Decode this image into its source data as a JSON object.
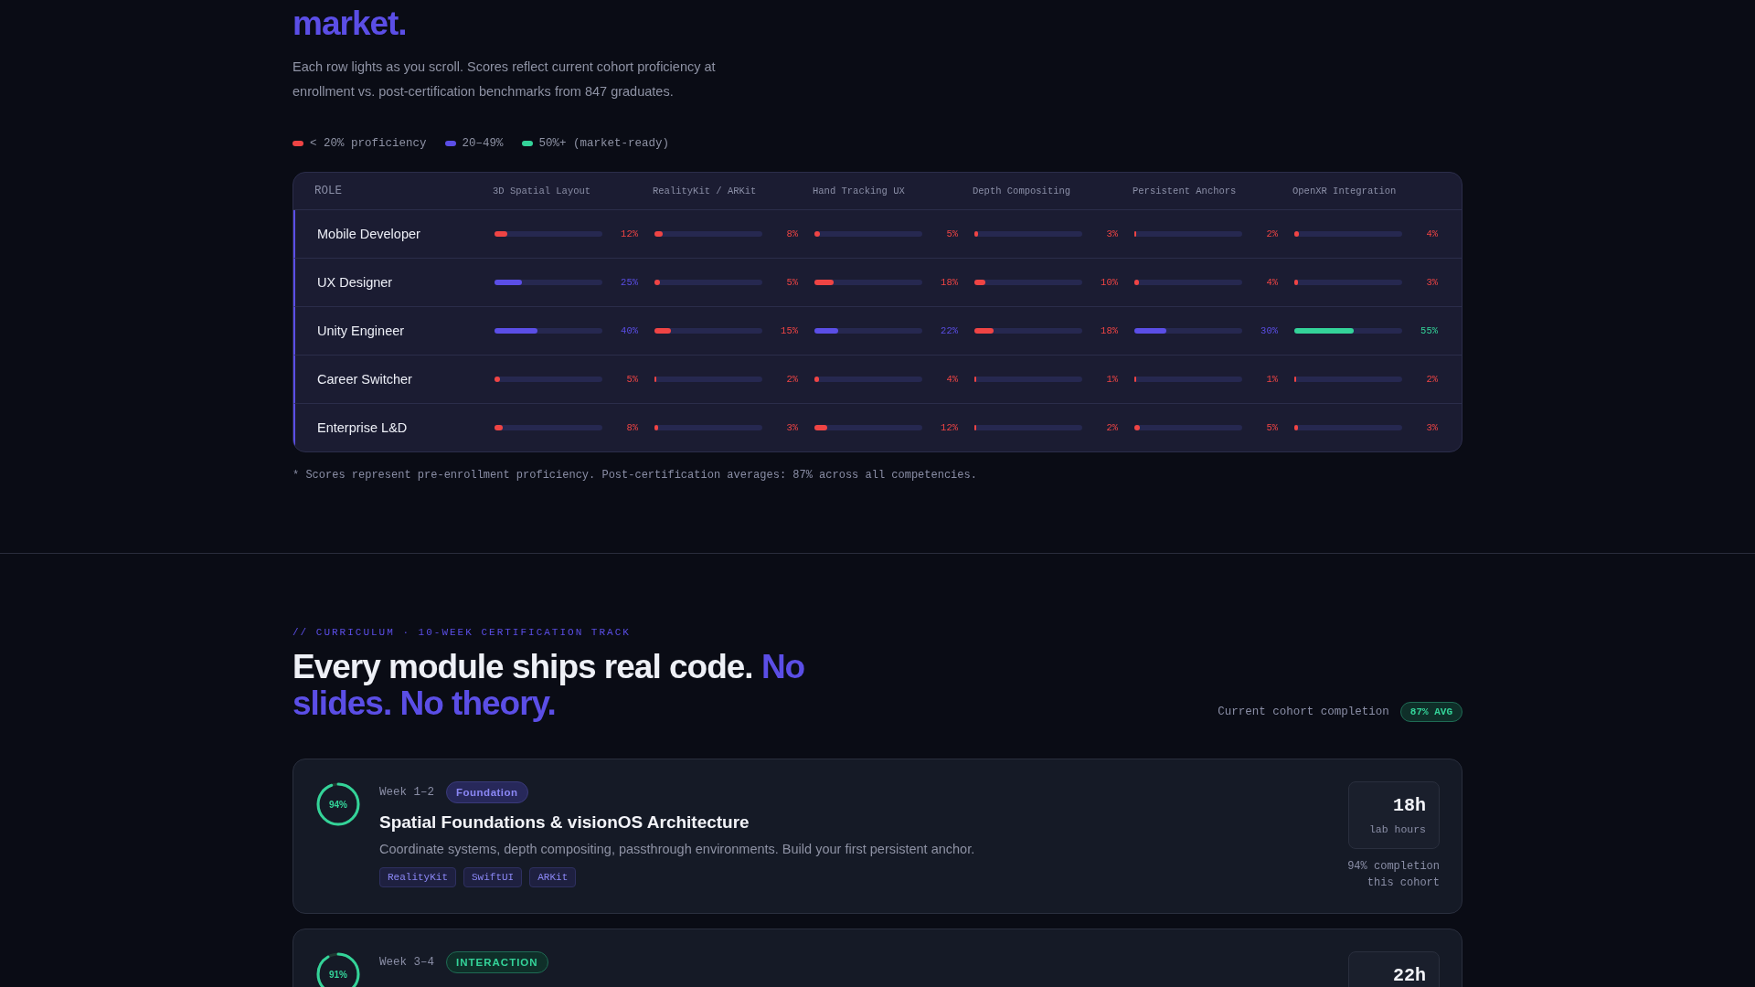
{
  "skills_section": {
    "heading": "market.",
    "intro": "Each row lights as you scroll. Scores reflect current cohort proficiency at enrollment vs. post-certification benchmarks from 847 graduates.",
    "legend": [
      {
        "label": "< 20% proficiency",
        "color": "#ef4444"
      },
      {
        "label": "20–49%",
        "color": "#5b4ee6"
      },
      {
        "label": "50%+ (market-ready)",
        "color": "#34d399"
      }
    ],
    "table": {
      "columns": [
        "ROLE",
        "3D Spatial Layout",
        "RealityKit / ARKit",
        "Hand Tracking UX",
        "Depth Compositing",
        "Persistent Anchors",
        "OpenXR Integration"
      ],
      "rows": [
        {
          "role": "Mobile Developer",
          "scores": [
            {
              "level": 0.12,
              "reading": "12%",
              "color": "#ef4444"
            },
            {
              "level": 0.08,
              "reading": "8%",
              "color": "#ef4444"
            },
            {
              "level": 0.05,
              "reading": "5%",
              "color": "#ef4444"
            },
            {
              "level": 0.03,
              "reading": "3%",
              "color": "#ef4444"
            },
            {
              "level": 0.02,
              "reading": "2%",
              "color": "#ef4444"
            },
            {
              "level": 0.04,
              "reading": "4%",
              "color": "#ef4444"
            }
          ]
        },
        {
          "role": "UX Designer",
          "scores": [
            {
              "level": 0.25,
              "reading": "25%",
              "color": "#5b4ee6"
            },
            {
              "level": 0.05,
              "reading": "5%",
              "color": "#ef4444"
            },
            {
              "level": 0.18,
              "reading": "18%",
              "color": "#ef4444"
            },
            {
              "level": 0.1,
              "reading": "10%",
              "color": "#ef4444"
            },
            {
              "level": 0.04,
              "reading": "4%",
              "color": "#ef4444"
            },
            {
              "level": 0.03,
              "reading": "3%",
              "color": "#ef4444"
            }
          ]
        },
        {
          "role": "Unity Engineer",
          "scores": [
            {
              "level": 0.4,
              "reading": "40%",
              "color": "#5b4ee6"
            },
            {
              "level": 0.15,
              "reading": "15%",
              "color": "#ef4444"
            },
            {
              "level": 0.22,
              "reading": "22%",
              "color": "#5b4ee6"
            },
            {
              "level": 0.18,
              "reading": "18%",
              "color": "#ef4444"
            },
            {
              "level": 0.3,
              "reading": "30%",
              "color": "#5b4ee6"
            },
            {
              "level": 0.55,
              "reading": "55%",
              "color": "#34d399"
            }
          ]
        },
        {
          "role": "Career Switcher",
          "scores": [
            {
              "level": 0.05,
              "reading": "5%",
              "color": "#ef4444"
            },
            {
              "level": 0.02,
              "reading": "2%",
              "color": "#ef4444"
            },
            {
              "level": 0.04,
              "reading": "4%",
              "color": "#ef4444"
            },
            {
              "level": 0.01,
              "reading": "1%",
              "color": "#ef4444"
            },
            {
              "level": 0.01,
              "reading": "1%",
              "color": "#ef4444"
            },
            {
              "level": 0.02,
              "reading": "2%",
              "color": "#ef4444"
            }
          ]
        },
        {
          "role": "Enterprise L&D",
          "scores": [
            {
              "level": 0.08,
              "reading": "8%",
              "color": "#ef4444"
            },
            {
              "level": 0.03,
              "reading": "3%",
              "color": "#ef4444"
            },
            {
              "level": 0.12,
              "reading": "12%",
              "color": "#ef4444"
            },
            {
              "level": 0.02,
              "reading": "2%",
              "color": "#ef4444"
            },
            {
              "level": 0.05,
              "reading": "5%",
              "color": "#ef4444"
            },
            {
              "level": 0.03,
              "reading": "3%",
              "color": "#ef4444"
            }
          ]
        }
      ]
    },
    "footnote": "* Scores represent pre-enrollment proficiency. Post-certification averages: 87% across all competencies."
  },
  "curriculum": {
    "eyebrow": "// CURRICULUM · 10-WEEK CERTIFICATION TRACK",
    "heading_plain": "Every module ships real code.",
    "heading_accent": "No slides. No theory.",
    "completion_label": "Current cohort completion",
    "completion_badge": "87% AVG",
    "modules": [
      {
        "ring_label": "94%",
        "weeks": "Week 1–2",
        "tag": {
          "label": "Foundation",
          "kind": "foundation"
        },
        "title": "Spatial Foundations & visionOS Architecture",
        "description": "Coordinate systems, depth compositing, passthrough environments. Build your first persistent anchor.",
        "tools": [
          "RealityKit",
          "SwiftUI",
          "ARKit"
        ],
        "hours": "18h",
        "hours_label": "lab hours",
        "completion": "94% completion this cohort"
      },
      {
        "ring_label": "91%",
        "weeks": "Week 3–4",
        "tag": {
          "label": "INTERACTION",
          "kind": "interaction"
        },
        "hours": "22h"
      }
    ]
  }
}
